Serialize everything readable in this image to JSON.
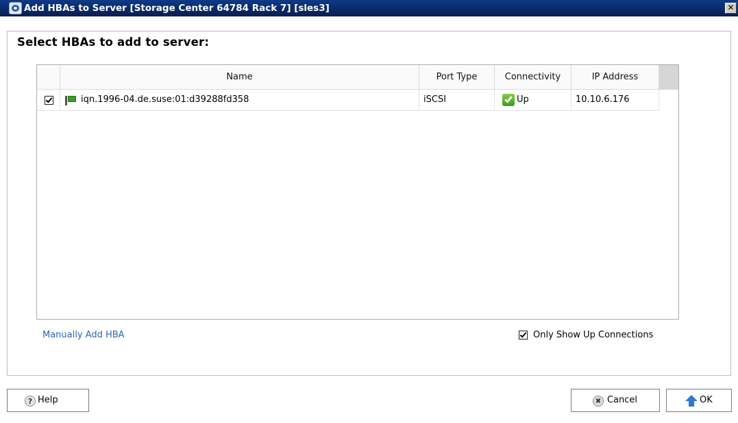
{
  "window": {
    "title": "Add HBAs to Server [Storage Center 64784 Rack 7] [sles3]",
    "close_glyph": "✕"
  },
  "dialog": {
    "heading": "Select HBAs to add to server:"
  },
  "table": {
    "columns": [
      "Name",
      "Port Type",
      "Connectivity",
      "IP Address"
    ],
    "rows": [
      {
        "checked": true,
        "name": "iqn.1996-04.de.suse:01:d39288fd358",
        "port_type": "iSCSI",
        "connectivity": "Up",
        "ip_address": "10.10.6.176",
        "name_icon": "hba-card-icon",
        "status_icon": "status-up-icon"
      }
    ]
  },
  "options": {
    "manual_add_label": "Manually Add HBA",
    "only_show_up_label": "Only Show Up Connections",
    "only_show_up_checked": true
  },
  "buttons": {
    "help_label": "Help",
    "cancel_label": "Cancel",
    "ok_label": "OK",
    "help_icon": "?",
    "cancel_icon": "✖"
  },
  "colors": {
    "title_bar": "#0a2b6a",
    "link": "#2a63b8",
    "status_up": "#3e9a1c",
    "ok_arrow": "#2e78d0"
  }
}
